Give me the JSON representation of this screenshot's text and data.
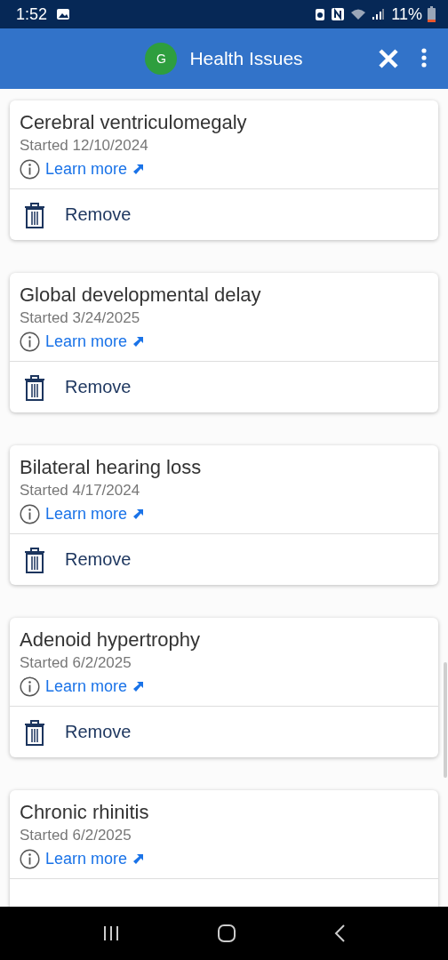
{
  "status_bar": {
    "time": "1:52",
    "battery": "11%"
  },
  "app_bar": {
    "avatar": "G",
    "title": "Health Issues"
  },
  "issues": [
    {
      "name": "Cerebral ventriculomegaly",
      "started": "Started 12/10/2024",
      "link": "Learn more",
      "action": "Remove"
    },
    {
      "name": "Global developmental delay",
      "started": "Started 3/24/2025",
      "link": "Learn more",
      "action": "Remove"
    },
    {
      "name": "Bilateral hearing loss",
      "started": "Started 4/17/2024",
      "link": "Learn more",
      "action": "Remove"
    },
    {
      "name": "Adenoid hypertrophy",
      "started": "Started 6/2/2025",
      "link": "Learn more",
      "action": "Remove"
    },
    {
      "name": "Chronic rhinitis",
      "started": "Started 6/2/2025",
      "link": "Learn more"
    }
  ]
}
